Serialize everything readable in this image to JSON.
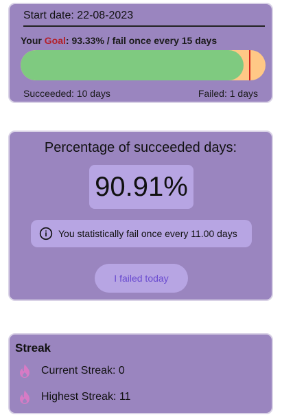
{
  "goal_card": {
    "start_date": "Start date: 22-08-2023",
    "goal_prefix": "Your ",
    "goal_word": "Goal",
    "goal_colon": ": ",
    "goal_percent": "93.33%",
    "goal_suffix": " / fail once every 15 days",
    "progress_fraction": 0.9091,
    "goal_marker_fraction": 0.9333,
    "succeeded_text": "Succeeded: 10 days",
    "failed_text": "Failed: 1 days",
    "colors": {
      "success": "#7fca80",
      "fail": "#ffc886",
      "goal_marker": "#d3221d",
      "goal_word": "#b3202a"
    }
  },
  "percentage_card": {
    "heading": "Percentage of succeeded days:",
    "percentage": "90.91%",
    "stat_icon": "info-icon",
    "stat_text": "You statistically fail once every 11.00 days",
    "fail_button_label": "I failed today"
  },
  "streak_card": {
    "title": "Streak",
    "icon": "flame-icon",
    "current_label": "Current Streak: 0",
    "highest_label": "Highest Streak: 11"
  },
  "theme": {
    "card_bg": "#9a85bf",
    "chip_bg": "#b7a5e3",
    "button_text": "#6a4bd0",
    "flame": "#d77bc5"
  }
}
